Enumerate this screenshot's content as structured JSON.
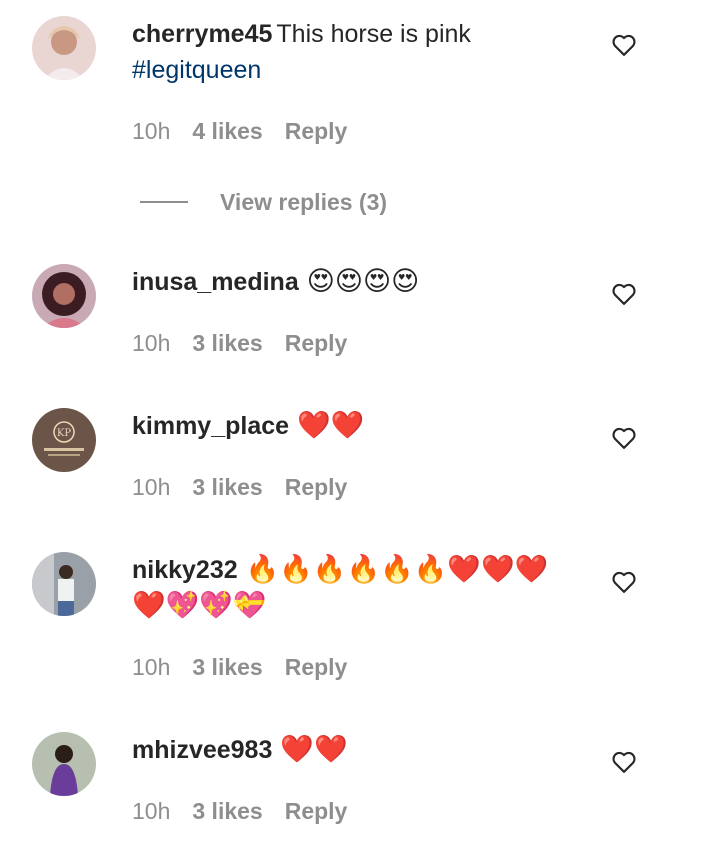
{
  "comments": [
    {
      "username": "cherryme45",
      "text": "This horse is pink",
      "hashtag": "#legitqueen",
      "time": "10h",
      "likes": "4 likes",
      "reply": "Reply",
      "view_replies": "View replies (3)"
    },
    {
      "username": "inusa_medina",
      "emoji": "😍😍😍😍",
      "time": "10h",
      "likes": "3 likes",
      "reply": "Reply"
    },
    {
      "username": "kimmy_place",
      "emoji": "❤️❤️",
      "time": "10h",
      "likes": "3 likes",
      "reply": "Reply"
    },
    {
      "username": "nikky232",
      "emoji": "🔥🔥🔥🔥🔥🔥❤️❤️❤️",
      "emoji_line2": "❤️💖💖💝",
      "time": "10h",
      "likes": "3 likes",
      "reply": "Reply"
    },
    {
      "username": "mhizvee983",
      "emoji": "❤️❤️",
      "time": "10h",
      "likes": "3 likes",
      "reply": "Reply"
    }
  ],
  "icons": {
    "like": "heart-outline-icon"
  },
  "colors": {
    "hashtag": "#00376b",
    "meta": "#8e8e8e",
    "text": "#262626"
  }
}
